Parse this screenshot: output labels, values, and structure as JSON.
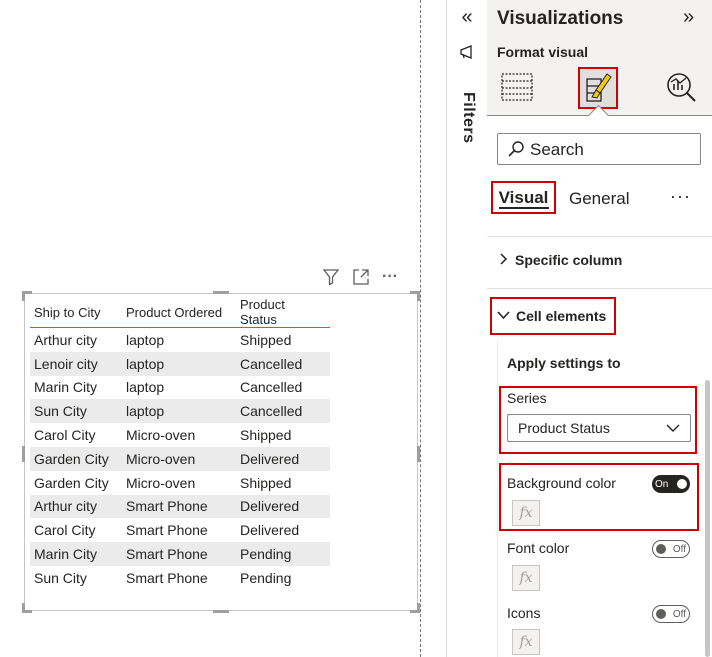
{
  "table": {
    "columns": [
      "Ship to City",
      "Product Ordered",
      "Product Status"
    ],
    "rows": [
      [
        "Arthur city",
        "laptop",
        "Shipped"
      ],
      [
        "Lenoir city",
        "laptop",
        "Cancelled"
      ],
      [
        "Marin City",
        "laptop",
        "Cancelled"
      ],
      [
        "Sun City",
        "laptop",
        "Cancelled"
      ],
      [
        "Carol City",
        "Micro-oven",
        "Shipped"
      ],
      [
        "Garden City",
        "Micro-oven",
        "Delivered"
      ],
      [
        "Garden City",
        "Micro-oven",
        "Shipped"
      ],
      [
        "Arthur city",
        "Smart Phone",
        "Delivered"
      ],
      [
        "Carol City",
        "Smart Phone",
        "Delivered"
      ],
      [
        "Marin City",
        "Smart Phone",
        "Pending"
      ],
      [
        "Sun City",
        "Smart Phone",
        "Pending"
      ]
    ]
  },
  "visual_header": {
    "icons": [
      "filter-icon",
      "focus-mode-icon",
      "more-options-icon"
    ],
    "more": "···"
  },
  "filters": {
    "label": "Filters",
    "collapse_glyph": "«"
  },
  "visualizations": {
    "title": "Visualizations",
    "expand_glyph": "»",
    "subtitle": "Format visual",
    "search": {
      "placeholder": "Search"
    },
    "tabs": {
      "visual": "Visual",
      "general": "General",
      "more": "···"
    },
    "sections": {
      "specific_column": "Specific column",
      "cell_elements": "Cell elements"
    },
    "apply_settings": "Apply settings to",
    "series": {
      "label": "Series",
      "selected": "Product Status"
    },
    "settings": {
      "background_color": {
        "label": "Background color",
        "toggle": "On"
      },
      "font_color": {
        "label": "Font color",
        "toggle": "Off"
      },
      "icons": {
        "label": "Icons",
        "toggle": "Off"
      },
      "fx": "fx"
    }
  },
  "colors": {
    "highlight": "#d00000",
    "accent_underline": "#2b88d8",
    "alt_row": "#ebebeb",
    "format_icon": "#f2c811"
  }
}
